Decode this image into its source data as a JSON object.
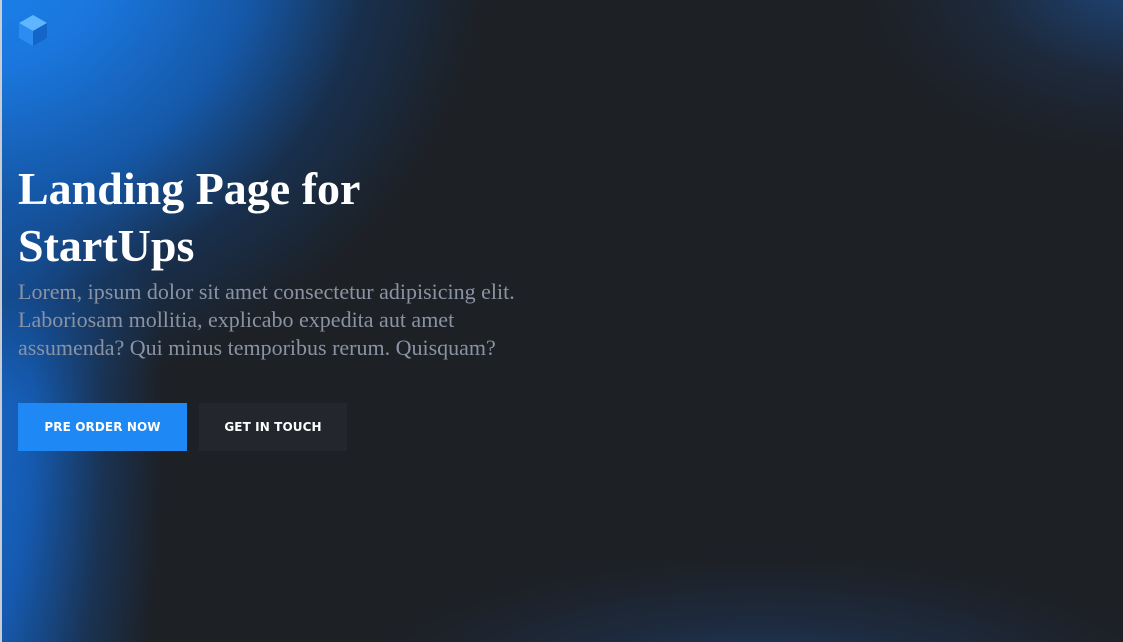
{
  "logo": {
    "icon": "cube-icon",
    "colors": {
      "light": "#5fb6ff",
      "mid": "#2c8cf2",
      "dark": "#1565c8"
    }
  },
  "hero": {
    "title": "Landing Page for StartUps",
    "text": "Lorem, ipsum dolor sit amet consectetur adipisicing elit. Laboriosam mollitia, explicabo expedita aut amet assumenda? Qui minus temporibus rerum. Quisquam?"
  },
  "buttons": {
    "primary_label": "PRE ORDER NOW",
    "secondary_label": "GET IN TOUCH"
  },
  "colors": {
    "accent": "#1e88f5",
    "background": "#1d2025",
    "secondary_button": "#23262d",
    "muted_text": "#8a93a3"
  }
}
